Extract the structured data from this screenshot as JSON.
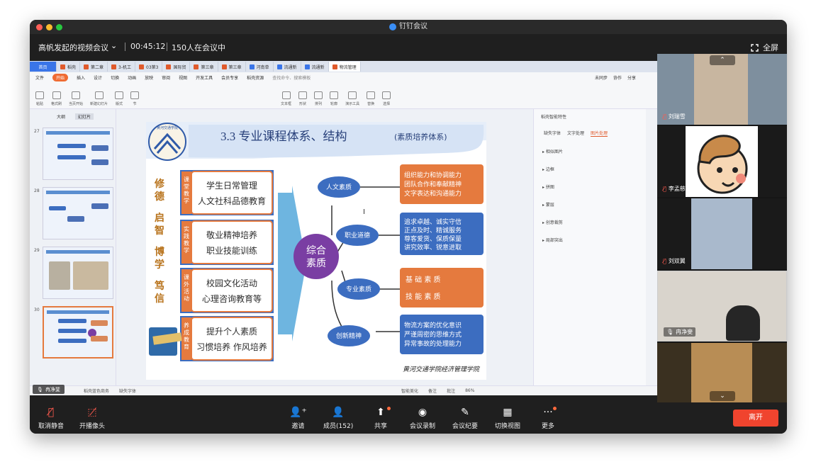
{
  "app": {
    "title": "钉钉会议"
  },
  "meeting": {
    "title": "高帆发起的视频会议",
    "chevron": "⌄",
    "elapsed": "00:45:12",
    "attendance": "150人在会议中",
    "fullscreen_label": "全屏"
  },
  "wps": {
    "tabs": [
      {
        "label": "首页"
      },
      {
        "label": "稻壳"
      },
      {
        "label": "第二章"
      },
      {
        "label": "3-机工"
      },
      {
        "label": "03第3"
      },
      {
        "label": "国际贸"
      },
      {
        "label": "第三章"
      },
      {
        "label": "第三章"
      },
      {
        "label": "河南单"
      },
      {
        "label": "流通新"
      },
      {
        "label": "流通新"
      },
      {
        "label": "物流管理"
      }
    ],
    "menu": [
      "文件",
      "开始",
      "插入",
      "设计",
      "切换",
      "动画",
      "放映",
      "审阅",
      "视图",
      "开发工具",
      "会员专享",
      "稻壳资源"
    ],
    "menu_active": "开始",
    "search_placeholder": "查找命令、搜索模板",
    "right_links": [
      "未同步",
      "协作",
      "分享"
    ],
    "ribbon": [
      "粘贴",
      "格式刷",
      "当页开始",
      "新建幻灯片",
      "版式",
      "节",
      "文本框",
      "形状",
      "排列",
      "轮廓",
      "演示工具",
      "替换",
      "选择"
    ],
    "thumb_tabs": [
      "大纲",
      "幻灯片"
    ],
    "thumb_numbers": [
      "27",
      "28",
      "29",
      "30"
    ],
    "add_slide": "+",
    "right_panel": {
      "header": "稻壳智能特性",
      "tabs": [
        "缺失字体",
        "文字处理",
        "图片处理"
      ],
      "items": [
        "相似图片",
        "边框",
        "拼图",
        "蒙层",
        "创意裁剪",
        "局部突出"
      ]
    },
    "status": {
      "theme": "稻壳蓝色商务",
      "missing_font": "缺失字体",
      "beautify": "智能美化",
      "notes": "备注",
      "comments": "批注",
      "zoom": "86%"
    }
  },
  "slide": {
    "logo_text": "黄河交通学院",
    "title": "3.3 专业课程体系、结构",
    "subtitle": "(素质培养体系)",
    "left_chars": [
      "修",
      "德",
      "启",
      "智",
      "博",
      "学",
      "笃",
      "信"
    ],
    "rows": [
      {
        "tag": "课堂教学",
        "lines": [
          "学生日常管理",
          "人文社科品德教育"
        ]
      },
      {
        "tag": "实践教学",
        "lines": [
          "敬业精神培养",
          "职业技能训练"
        ]
      },
      {
        "tag": "课外活动",
        "lines": [
          "校园文化活动",
          "心理咨询教育等"
        ]
      },
      {
        "tag": "养成教育",
        "lines": [
          "提升个人素质",
          "习惯培养 作风培养"
        ]
      }
    ],
    "center": "综合\n素质",
    "center_lines": [
      "综合",
      "素质"
    ],
    "branches": [
      {
        "label": "人文素质",
        "detail": [
          "组织能力和协调能力",
          "团队合作和奉献精神",
          "文字表达和沟通能力"
        ]
      },
      {
        "label": "职业道德",
        "detail": [
          "追求卓越、诚实守信",
          "正点及时、精诚服务",
          "尊客爱货、保质保量",
          "讲究效率、锐意进取"
        ]
      },
      {
        "label": "专业素质",
        "detail": [
          "基 础 素 质",
          "技 能 素 质"
        ]
      },
      {
        "label": "创新精神",
        "detail": [
          "物流方案的优化意识",
          "严谨周密的思维方式",
          "异常事故的处理能力"
        ]
      }
    ],
    "footer": "黄河交通学院经济管理学院"
  },
  "presenter_tag": "冉净斐",
  "participants": [
    {
      "name": "刘瑞雪",
      "muted": true
    },
    {
      "name": "李孟慈",
      "muted": true
    },
    {
      "name": "刘双翼",
      "muted": true
    },
    {
      "name": "冉净斐",
      "muted": false
    }
  ],
  "toolbar": {
    "buttons": [
      {
        "label": "取消静音",
        "icon": "mic-off-icon"
      },
      {
        "label": "开播像头",
        "icon": "camera-off-icon"
      },
      {
        "label": "邀请",
        "icon": "invite-icon"
      },
      {
        "label": "成员(152)",
        "icon": "members-icon"
      },
      {
        "label": "共享",
        "icon": "share-icon"
      },
      {
        "label": "会议录制",
        "icon": "record-icon"
      },
      {
        "label": "会议纪要",
        "icon": "minutes-icon"
      },
      {
        "label": "切换视图",
        "icon": "grid-icon"
      },
      {
        "label": "更多",
        "icon": "more-icon"
      }
    ],
    "leave": "离开"
  },
  "colors": {
    "accent": "#3a75e8",
    "leave": "#f0442e",
    "slide_orange": "#e57a3e",
    "slide_blue": "#3c6dc0",
    "center": "#7a3ea3"
  }
}
